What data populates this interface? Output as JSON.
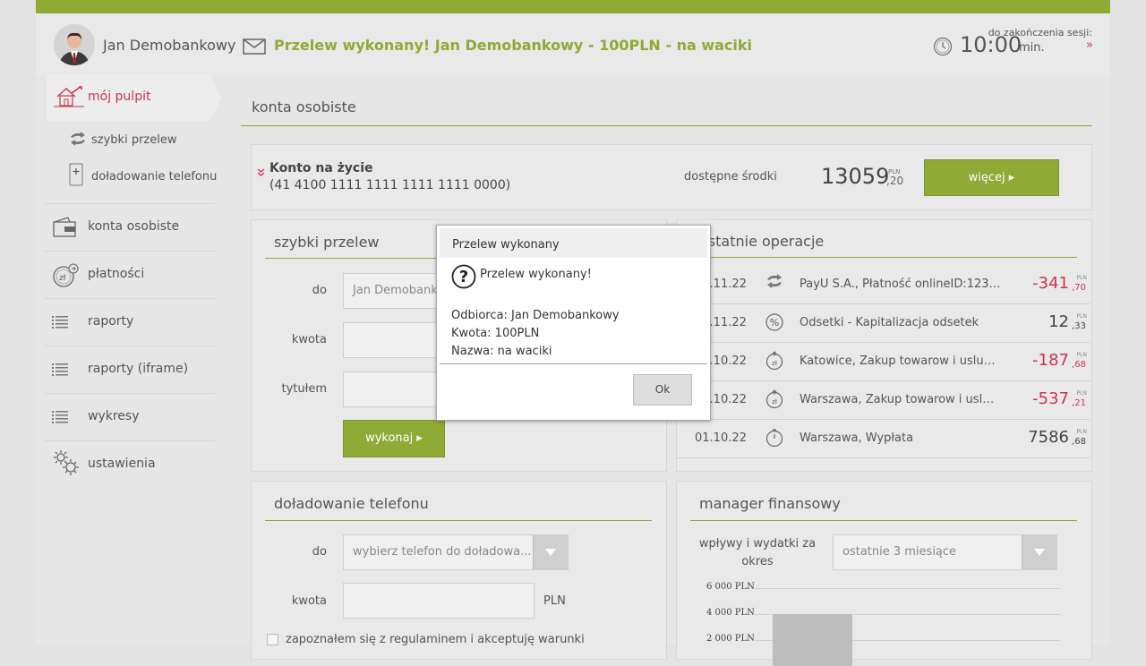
{
  "header": {
    "username": "Jan Demobankowy",
    "notice": "Przelew wykonany! Jan Demobankowy - 100PLN - na waciki",
    "session_label": "do zakończenia sesji:",
    "session_time": "10:00",
    "session_unit": "min.",
    "session_more": "»"
  },
  "sidebar": {
    "active": "mój pulpit",
    "sub_items": [
      "szybki przelew",
      "doładowanie telefonu"
    ],
    "items": [
      "konta osobiste",
      "płatności",
      "raporty",
      "raporty (iframe)",
      "wykresy",
      "ustawienia"
    ]
  },
  "accounts": {
    "title": "konta osobiste",
    "account_name": "Konto na życie",
    "account_number": "(41 4100 1111 1111 1111 1111 0000)",
    "available_label": "dostępne środki",
    "balance_int": "13059",
    "balance_currency": "PLN",
    "balance_dec": ",20",
    "more_button": "więcej ▸"
  },
  "quick_transfer": {
    "title": "szybki przelew",
    "to_label": "do",
    "to_value": "Jan Demobankowy",
    "amount_label": "kwota",
    "title_label": "tytułem",
    "submit": "wykonaj ▸"
  },
  "operations": {
    "title": "ostatnie operacje",
    "rows": [
      {
        "date": "01.11.22",
        "desc": "PayU S.A., Płatność onlineID:1234...",
        "int": "-341",
        "dec": ",70",
        "cur": "PLN",
        "negative": true
      },
      {
        "date": "01.11.22",
        "desc": "Odsetki - Kapitalizacja odsetek",
        "int": "12",
        "dec": ",33",
        "cur": "PLN",
        "negative": false
      },
      {
        "date": "01.10.22",
        "desc": "Katowice, Zakup towarow i uslug ...",
        "int": "-187",
        "dec": ",68",
        "cur": "PLN",
        "negative": true
      },
      {
        "date": "01.10.22",
        "desc": "Warszawa, Zakup towarow i uslug...",
        "int": "-537",
        "dec": ",21",
        "cur": "PLN",
        "negative": true
      },
      {
        "date": "01.10.22",
        "desc": "Warszawa, Wypłata",
        "int": "7586",
        "dec": ",68",
        "cur": "PLN",
        "negative": false
      }
    ]
  },
  "phone_topup": {
    "title": "doładowanie telefonu",
    "to_label": "do",
    "phone_placeholder": "wybierz telefon do doładowa...",
    "amount_label": "kwota",
    "currency": "PLN",
    "terms": "zapoznałem się z regulaminem i akceptuję warunki"
  },
  "finance_manager": {
    "title": "manager finansowy",
    "label_line1": "wpływy i wydatki za",
    "label_line2": "okres",
    "period": "ostatnie 3 miesiące"
  },
  "chart_data": {
    "type": "bar",
    "y_ticks": [
      "6 000 PLN",
      "4 000 PLN",
      "2 000 PLN"
    ],
    "ylim": [
      0,
      6000
    ],
    "categories": [
      ""
    ],
    "values": [
      4000
    ],
    "bar_color": "#bdbdbd"
  },
  "modal": {
    "title": "Przelew wykonany",
    "message": "Przelew wykonany!",
    "lines": [
      "Odbiorca: Jan Demobankowy",
      "Kwota: 100PLN",
      "Nazwa: na waciki"
    ],
    "ok": "Ok"
  },
  "colors": {
    "accent": "#8faa35",
    "negative": "#c8364e",
    "text": "#444444"
  }
}
